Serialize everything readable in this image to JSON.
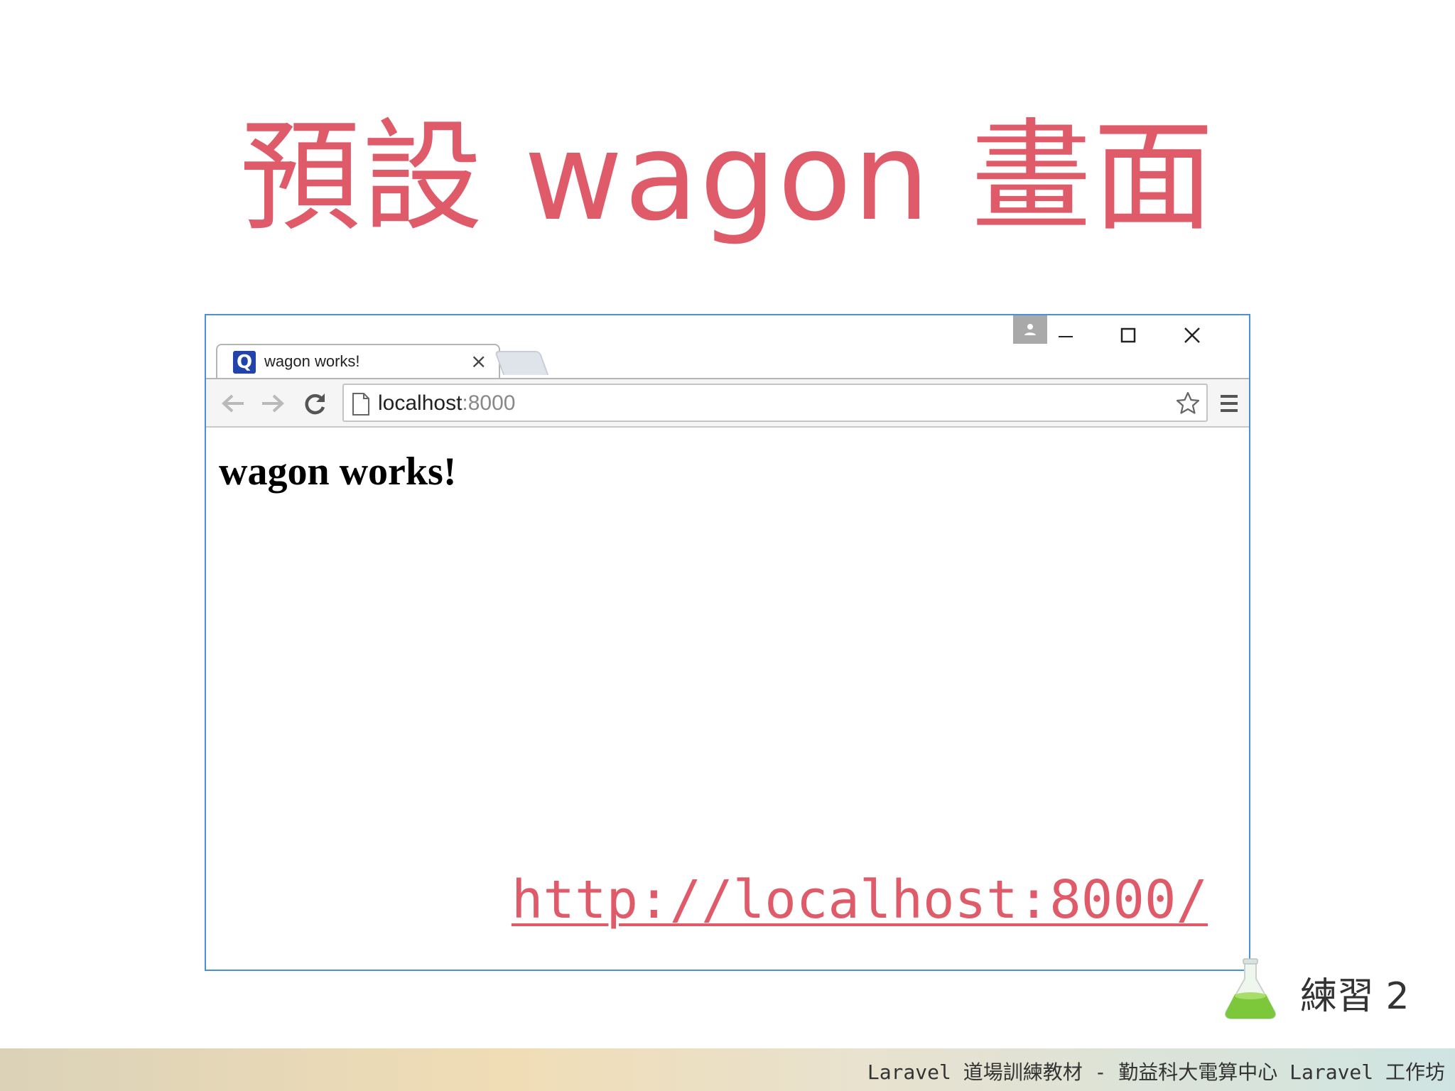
{
  "slide": {
    "title": "預設 wagon 畫面"
  },
  "browser": {
    "tab_title": "wagon works!",
    "tab_close": "×",
    "favicon_letter": "Q",
    "url_host": "localhost",
    "url_port": ":8000",
    "page_heading": "wagon works!"
  },
  "link": {
    "text": "http://localhost:8000/"
  },
  "exercise": {
    "label": "練習 2"
  },
  "footer": {
    "text": "Laravel 道場訓練教材 - 勤益科大電算中心 Laravel 工作坊"
  },
  "colors": {
    "accent": "#e05b69",
    "window_border": "#4a90d9"
  }
}
